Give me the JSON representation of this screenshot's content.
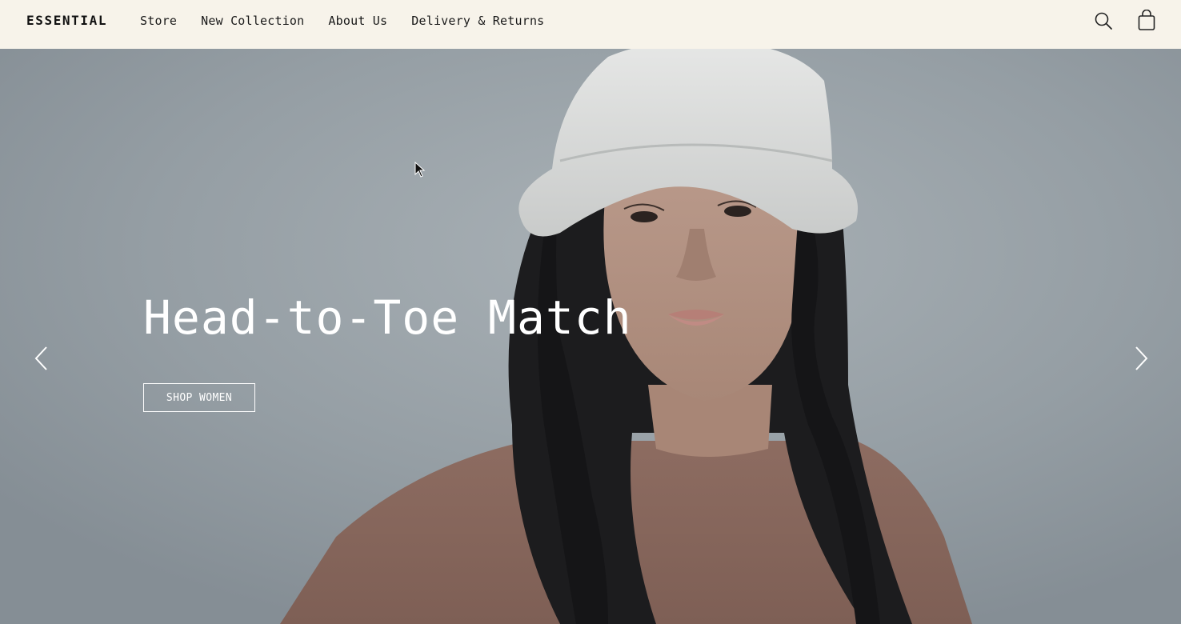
{
  "header": {
    "logo": "ESSENTIAL",
    "nav": [
      {
        "label": "Store"
      },
      {
        "label": "New Collection"
      },
      {
        "label": "About Us"
      },
      {
        "label": "Delivery & Returns"
      }
    ],
    "icons": {
      "search": "search-icon",
      "cart": "shopping-bag-icon"
    }
  },
  "hero": {
    "title": "Head-to-Toe Match",
    "cta_label": "SHOP WOMEN",
    "prev_icon": "chevron-left-icon",
    "next_icon": "chevron-right-icon"
  },
  "colors": {
    "header_bg": "#f7f3ea",
    "hero_bg": "#99a2a8",
    "text_on_hero": "#ffffff",
    "shirt": "#8e6a5f"
  }
}
